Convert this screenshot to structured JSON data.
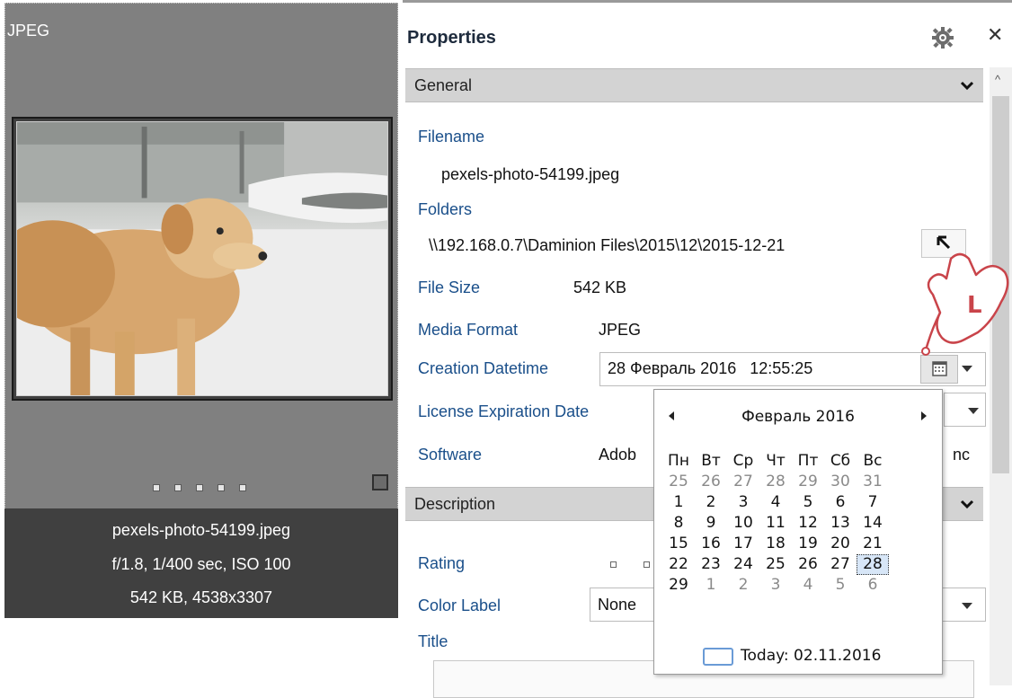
{
  "thumbnail": {
    "format_label": "JPEG",
    "filename": "pexels-photo-54199.jpeg",
    "exposure": "f/1.8, 1/400 sec, ISO 100",
    "size_dims": "542 KB, 4538x3307"
  },
  "properties": {
    "title": "Properties",
    "sections": {
      "general": "General",
      "description": "Description"
    },
    "fields": {
      "filename_label": "Filename",
      "filename_value": "pexels-photo-54199.jpeg",
      "folders_label": "Folders",
      "folders_value": "\\\\192.168.0.7\\Daminion Files\\2015\\12\\2015-12-21",
      "filesize_label": "File Size",
      "filesize_value": "542 KB",
      "mediaformat_label": "Media Format",
      "mediaformat_value": "JPEG",
      "creation_label": "Creation Datetime",
      "creation_value": "28 Февраль 2016   12:55:25",
      "license_label": "License Expiration Date",
      "software_label": "Software",
      "software_value_start": "Adob",
      "software_value_end": "nc",
      "rating_label": "Rating",
      "colorlabel_label": "Color Label",
      "colorlabel_value": "None",
      "title_label": "Title"
    }
  },
  "calendar": {
    "month_label": "Февраль 2016",
    "weekdays": [
      "Пн",
      "Вт",
      "Ср",
      "Чт",
      "Пт",
      "Сб",
      "Вс"
    ],
    "weeks": [
      [
        "25",
        "26",
        "27",
        "28",
        "29",
        "30",
        "31"
      ],
      [
        "1",
        "2",
        "3",
        "4",
        "5",
        "6",
        "7"
      ],
      [
        "8",
        "9",
        "10",
        "11",
        "12",
        "13",
        "14"
      ],
      [
        "15",
        "16",
        "17",
        "18",
        "19",
        "20",
        "21"
      ],
      [
        "22",
        "23",
        "24",
        "25",
        "26",
        "27",
        "28"
      ],
      [
        "29",
        "1",
        "2",
        "3",
        "4",
        "5",
        "6"
      ]
    ],
    "dim_cells": [
      [
        0,
        0
      ],
      [
        0,
        1
      ],
      [
        0,
        2
      ],
      [
        0,
        3
      ],
      [
        0,
        4
      ],
      [
        0,
        5
      ],
      [
        0,
        6
      ],
      [
        5,
        1
      ],
      [
        5,
        2
      ],
      [
        5,
        3
      ],
      [
        5,
        4
      ],
      [
        5,
        5
      ],
      [
        5,
        6
      ]
    ],
    "selected_cell": [
      4,
      6
    ],
    "today_label": "Today: 02.11.2016"
  },
  "hand_letter": "L"
}
